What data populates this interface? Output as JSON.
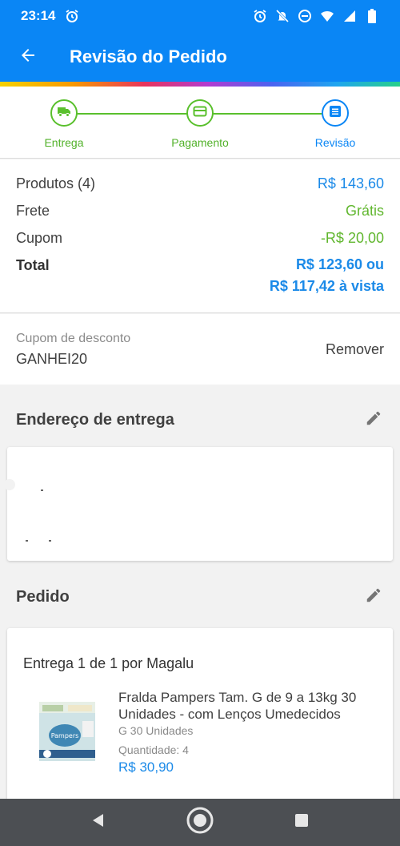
{
  "status_bar": {
    "time": "23:14",
    "icons": [
      "alarm-icon",
      "alarm-icon",
      "notifications-off-icon",
      "do-not-disturb-icon",
      "wifi-icon",
      "signal-icon",
      "battery-icon"
    ]
  },
  "app_bar": {
    "title": "Revisão do Pedido",
    "back_icon": "arrow-left-icon"
  },
  "stepper": {
    "steps": [
      {
        "label": "Entrega",
        "icon": "truck-icon",
        "state": "done"
      },
      {
        "label": "Pagamento",
        "icon": "card-icon",
        "state": "done"
      },
      {
        "label": "Revisão",
        "icon": "list-icon",
        "state": "active"
      }
    ],
    "colors": {
      "done": "#5ac02d",
      "active": "#0a86f5"
    }
  },
  "summary": {
    "products_label": "Produtos (4)",
    "products_value": "R$ 143,60",
    "shipping_label": "Frete",
    "shipping_value": "Grátis",
    "coupon_label": "Cupom",
    "coupon_value": "-R$ 20,00",
    "total_label": "Total",
    "total_value_line1": "R$ 123,60 ou",
    "total_value_line2": "R$ 117,42 à vista"
  },
  "coupon": {
    "placeholder": "Cupom de desconto",
    "code": "GANHEI20",
    "remove_label": "Remover"
  },
  "address_section": {
    "title": "Endereço de entrega",
    "edit_icon": "pencil-icon"
  },
  "order_section": {
    "title": "Pedido",
    "edit_icon": "pencil-icon",
    "delivery_title": "Entrega 1 de 1 por Magalu",
    "product": {
      "name": "Fralda Pampers Tam. G de 9 a 13kg 30 Unidades - com Lenços Umedecidos",
      "variant": "G 30 Unidades",
      "quantity": "Quantidade:  4",
      "price": "R$ 30,90"
    }
  },
  "nav_bar": {
    "icons": [
      "back-triangle-icon",
      "home-circle-icon",
      "recents-square-icon"
    ]
  },
  "colors": {
    "primary": "#0a86f5",
    "success": "#5ac02d",
    "price_blue": "#1b8ae8"
  }
}
